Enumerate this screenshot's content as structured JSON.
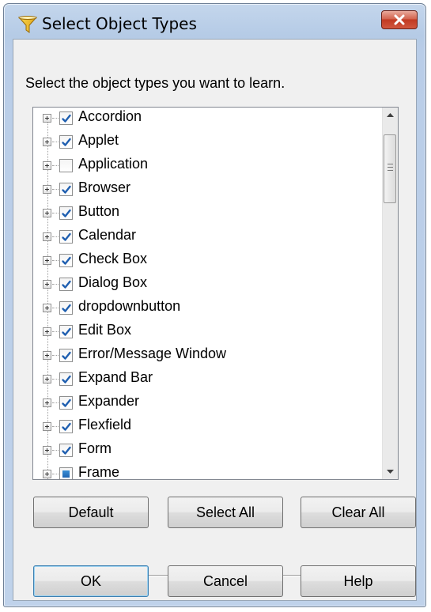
{
  "window": {
    "title": "Select Object Types",
    "close_icon": "close-x-icon",
    "title_icon": "filter-funnel-icon"
  },
  "prompt": "Select the object types you want to learn.",
  "tree": {
    "items": [
      {
        "label": "Accordion",
        "state": "checked"
      },
      {
        "label": "Applet",
        "state": "checked"
      },
      {
        "label": "Application",
        "state": "unchecked"
      },
      {
        "label": "Browser",
        "state": "checked"
      },
      {
        "label": "Button",
        "state": "checked"
      },
      {
        "label": "Calendar",
        "state": "checked"
      },
      {
        "label": "Check Box",
        "state": "checked"
      },
      {
        "label": "Dialog Box",
        "state": "checked"
      },
      {
        "label": "dropdownbutton",
        "state": "checked"
      },
      {
        "label": "Edit Box",
        "state": "checked"
      },
      {
        "label": "Error/Message Window",
        "state": "checked"
      },
      {
        "label": "Expand Bar",
        "state": "checked"
      },
      {
        "label": "Expander",
        "state": "checked"
      },
      {
        "label": "Flexfield",
        "state": "checked"
      },
      {
        "label": "Form",
        "state": "checked"
      },
      {
        "label": "Frame",
        "state": "partial"
      }
    ]
  },
  "buttons": {
    "default": "Default",
    "select_all": "Select All",
    "clear_all": "Clear All",
    "ok": "OK",
    "cancel": "Cancel",
    "help": "Help"
  },
  "colors": {
    "check_blue": "#1f5fb0",
    "close_red": "#c13a22"
  }
}
